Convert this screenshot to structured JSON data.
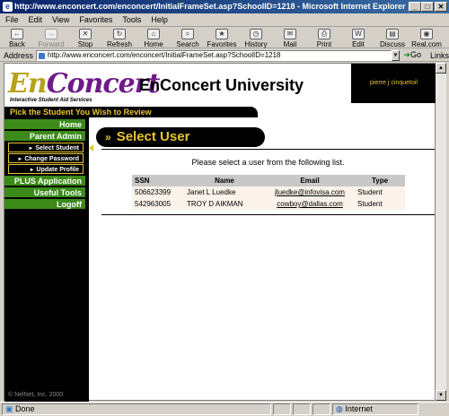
{
  "window": {
    "title": "http://www.enconcert.com/enconcert/InitialFrameSet.asp?SchoolID=1218 - Microsoft Internet Explorer"
  },
  "menu": [
    "File",
    "Edit",
    "View",
    "Favorites",
    "Tools",
    "Help"
  ],
  "toolbar": [
    {
      "label": "Back",
      "icon": "back-icon",
      "glyph": "←",
      "disabled": false
    },
    {
      "label": "Forward",
      "icon": "forward-icon",
      "glyph": "→",
      "disabled": true
    },
    {
      "label": "Stop",
      "icon": "stop-icon",
      "glyph": "✕",
      "disabled": false
    },
    {
      "label": "Refresh",
      "icon": "refresh-icon",
      "glyph": "↻",
      "disabled": false
    },
    {
      "label": "Home",
      "icon": "home-icon",
      "glyph": "⌂",
      "disabled": false
    },
    {
      "label": "Search",
      "icon": "search-icon",
      "glyph": "⌕",
      "disabled": false
    },
    {
      "label": "Favorites",
      "icon": "favorites-icon",
      "glyph": "★",
      "disabled": false
    },
    {
      "label": "History",
      "icon": "history-icon",
      "glyph": "◷",
      "disabled": false
    },
    {
      "label": "Mail",
      "icon": "mail-icon",
      "glyph": "✉",
      "disabled": false
    },
    {
      "label": "Print",
      "icon": "print-icon",
      "glyph": "⎙",
      "disabled": false
    },
    {
      "label": "Edit",
      "icon": "edit-icon",
      "glyph": "W",
      "disabled": false
    },
    {
      "label": "Discuss",
      "icon": "discuss-icon",
      "glyph": "▤",
      "disabled": false
    },
    {
      "label": "Real.com",
      "icon": "realcom-icon",
      "glyph": "◉",
      "disabled": false
    }
  ],
  "address": {
    "label": "Address",
    "url": "http://www.enconcert.com/enconcert/InitialFrameSet.asp?SchoolID=1218",
    "go": "Go",
    "links": "Links"
  },
  "site": {
    "logo_brand_a": "En",
    "logo_brand_b": "Concert",
    "logo_tagline": "Interactive Student Aid Services",
    "university": "EnConcert University",
    "user": "pierre j cinquetoil",
    "banner": "Pick the Student You Wish to Review",
    "copyright": "© NelNet, Inc. 2000",
    "accent_gold": "#e9c430",
    "nav_green": "#3b8a1a"
  },
  "nav": {
    "home": "Home",
    "parent_admin": "Parent Admin",
    "select_student": "Select Student",
    "change_password": "Change Password",
    "update_profile": "Update Profile",
    "plus_application": "PLUS Application",
    "useful_tools": "Useful Tools",
    "logoff": "Logoff"
  },
  "content": {
    "section_title": "Select User",
    "section_icon": "»",
    "intro": "Please select a user from the following list.",
    "columns": [
      "SSN",
      "Name",
      "Email",
      "Type"
    ],
    "rows": [
      {
        "ssn": "506623399",
        "name": "Janet L Luedke",
        "email": "jluedke@infovisa.com",
        "type": "Student"
      },
      {
        "ssn": "542963005",
        "name": "TROY D AIKMAN",
        "email": "cowboy@dallas.com",
        "type": "Student"
      }
    ]
  },
  "status": {
    "left": "Done",
    "zone": "Internet"
  }
}
